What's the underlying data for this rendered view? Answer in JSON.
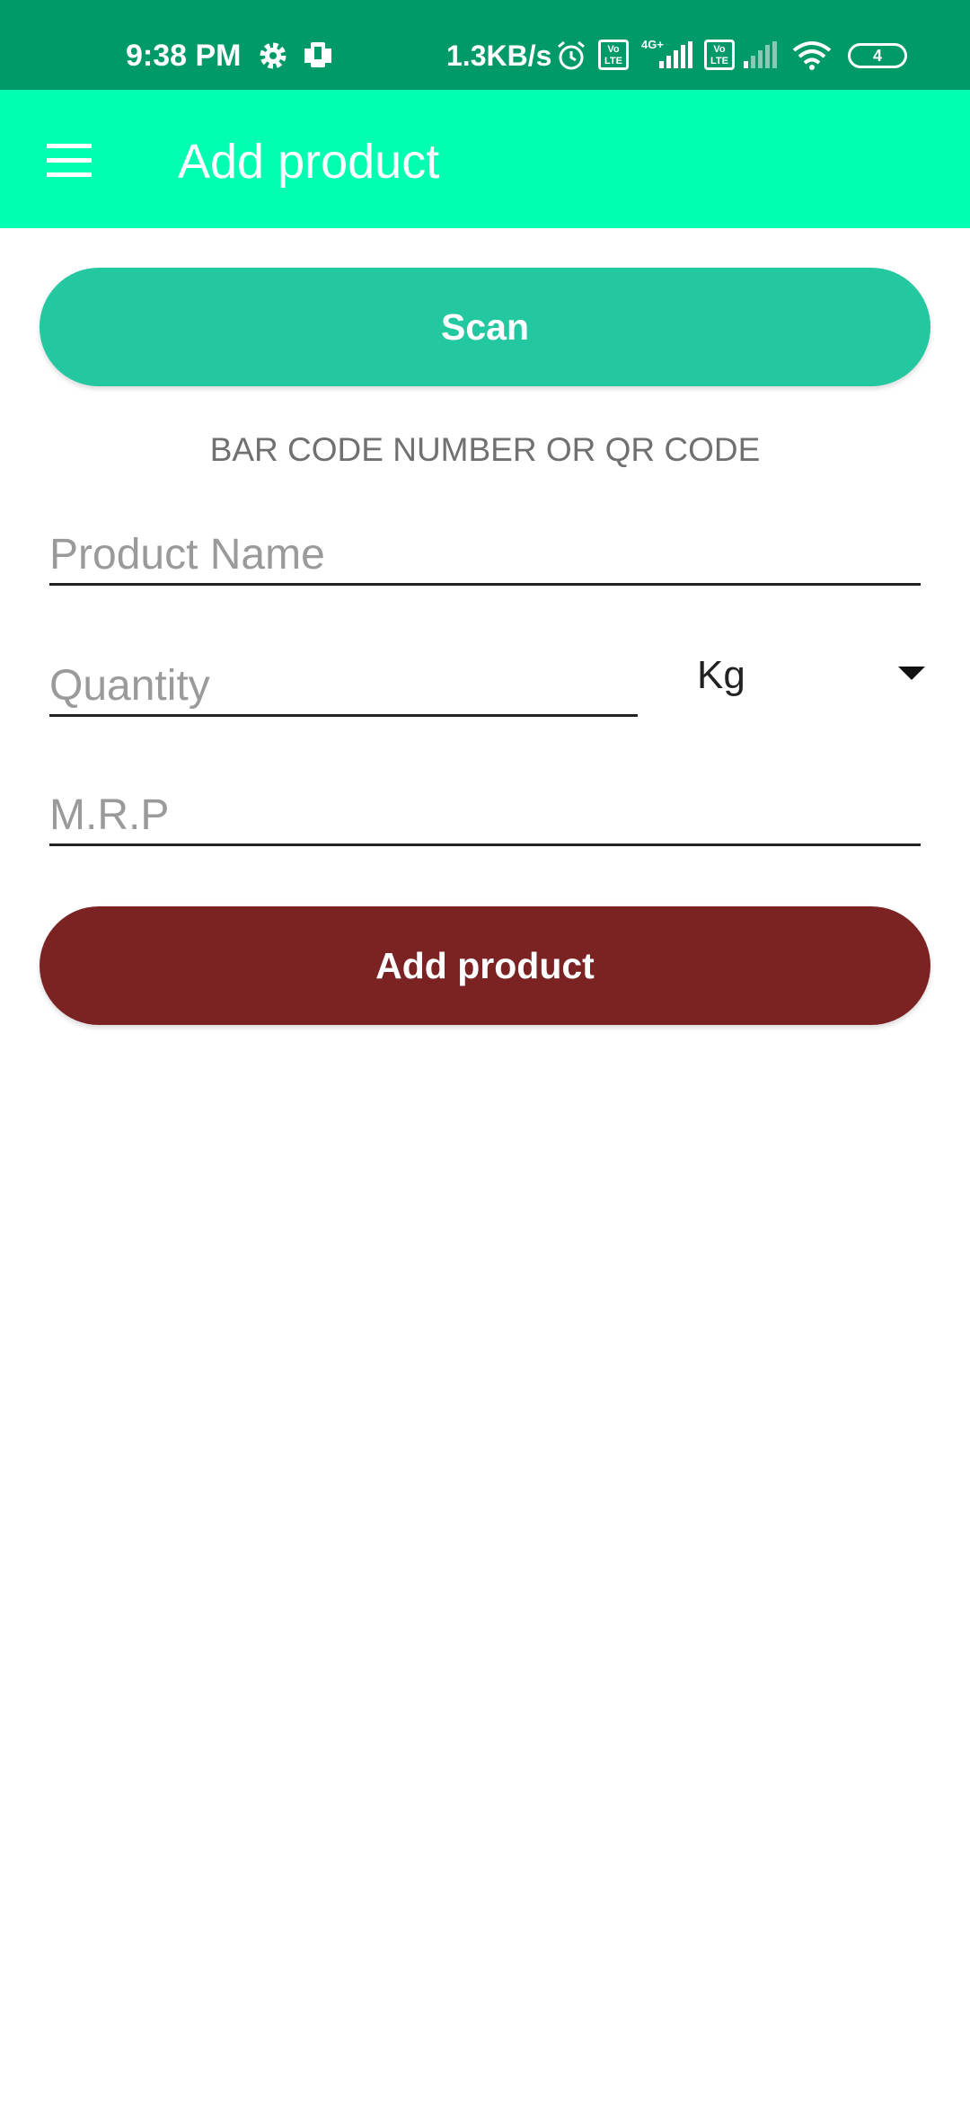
{
  "status_bar": {
    "time": "9:38 PM",
    "net_speed": "1.3KB/s",
    "volte_1": "Vo LTE",
    "network_type": "4G+",
    "volte_2": "Vo LTE",
    "battery": "4",
    "icons": [
      "gear-icon",
      "screen-mirror-icon",
      "alarm-icon",
      "signal-icon",
      "signal-weak-icon",
      "wifi-icon",
      "battery-icon"
    ]
  },
  "app_bar": {
    "title": "Add product",
    "menu_icon": "hamburger-menu-icon",
    "background": "#00ffb0"
  },
  "form": {
    "scan_label": "Scan",
    "barcode_text": "BAR CODE NUMBER OR QR CODE",
    "product_name_placeholder": "Product Name",
    "quantity_placeholder": "Quantity",
    "unit_selected": "Kg",
    "mrp_placeholder": "M.R.P",
    "add_label": "Add product"
  },
  "colors": {
    "status_bar": "#009968",
    "scan_button": "#23c8a0",
    "add_button": "#7b2223"
  }
}
